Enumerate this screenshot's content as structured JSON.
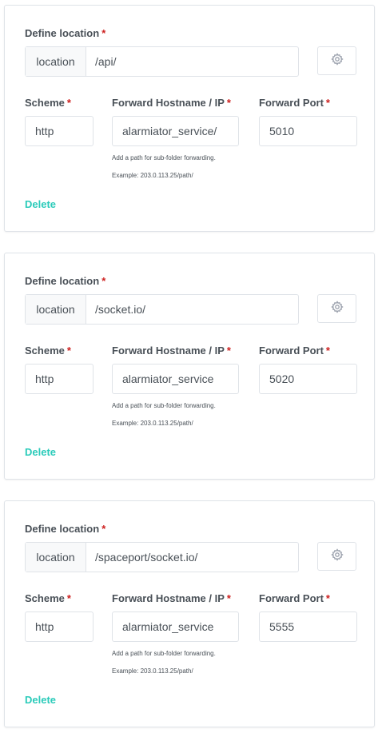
{
  "labels": {
    "define_location": "Define location",
    "scheme": "Scheme",
    "forward_host": "Forward Hostname / IP",
    "forward_port": "Forward Port",
    "required": "*",
    "location_prefix": "location",
    "hint_subfolder": "Add a path for sub-folder forwarding.",
    "hint_example": "Example: 203.0.113.25/path/",
    "delete": "Delete"
  },
  "locations": [
    {
      "path": "/api/",
      "scheme": "http",
      "host": "alarmiator_service/",
      "port": "5010"
    },
    {
      "path": "/socket.io/",
      "scheme": "http",
      "host": "alarmiator_service",
      "port": "5020"
    },
    {
      "path": "/spaceport/socket.io/",
      "scheme": "http",
      "host": "alarmiator_service",
      "port": "5555"
    }
  ],
  "colors": {
    "accent_teal": "#2bcbba",
    "required_red": "#cd201f",
    "border": "#dfe3e8"
  },
  "icons": {
    "advanced": "gear-icon"
  }
}
